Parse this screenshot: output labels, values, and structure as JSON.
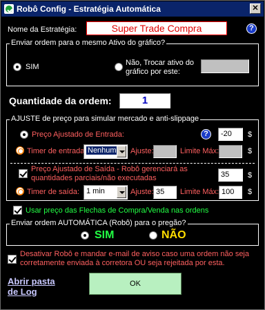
{
  "window": {
    "title": "Robô Config - Estratégia Automática",
    "close_label": "✕"
  },
  "strategy": {
    "label": "Nome da Estratégia:",
    "value": "Super Trade Compra",
    "help": "?"
  },
  "same_asset": {
    "group_title": "Enviar ordem para o mesmo Ativo do gráfico?",
    "yes_label": "SIM",
    "no_label_1": "Não, Trocar ativo do",
    "no_label_2": "gráfico por este:",
    "other_asset_value": ""
  },
  "quantity": {
    "label": "Quantidade da ordem:",
    "value": "1"
  },
  "slippage": {
    "group_title": "AJUSTE de preço para simular mercado e anti-slippage",
    "entry_price_label": "Preço Ajustado de Entrada:",
    "entry_help": "?",
    "entry_adjust_value": "-20",
    "currency": "$",
    "entry_timer_label": "Timer de entrada:",
    "entry_timer_value": "Nenhum",
    "entry_ajuste_label": "Ajuste:",
    "entry_ajuste_value": "",
    "entry_limit_label": "Limite Máx:",
    "entry_limit_value": "",
    "exit_price_label_1": "Preço Ajustado de Saída - Robô gerenciará as",
    "exit_price_label_2": "quantidades parciais/não executadas",
    "exit_adjust_value": "35",
    "exit_timer_label": "Timer de saída:",
    "exit_timer_value": "1 min",
    "exit_ajuste_label": "Ajuste:",
    "exit_ajuste_value": "35",
    "exit_limit_label": "Limite Máx:",
    "exit_limit_value": "100"
  },
  "arrows_option": {
    "label": "Usar preço das Flechas de Compra/Venda nas ordens"
  },
  "auto_order": {
    "group_title": "Enviar ordem AUTOMÁTICA (Robô) para o pregão?",
    "yes_label": "SIM",
    "no_label": "NÃO"
  },
  "disable_robot": {
    "label_1": "Desativar Robô e mandar e-mail de aviso caso uma ordem não seja",
    "label_2": "corretamente enviada à corretora OU seja rejeitada por esta."
  },
  "log_link": {
    "line_1": "Abrir pasta",
    "line_2": "de Log"
  },
  "ok_button": {
    "label": "OK"
  },
  "colors": {
    "titlebar": "#0a246a",
    "background": "#000000",
    "accent_red": "#ff6060",
    "accent_green": "#22ff44",
    "accent_yellow": "#ffdd00",
    "ok_button": "#b8f0c0",
    "help_icon": "#1a3cc8"
  }
}
